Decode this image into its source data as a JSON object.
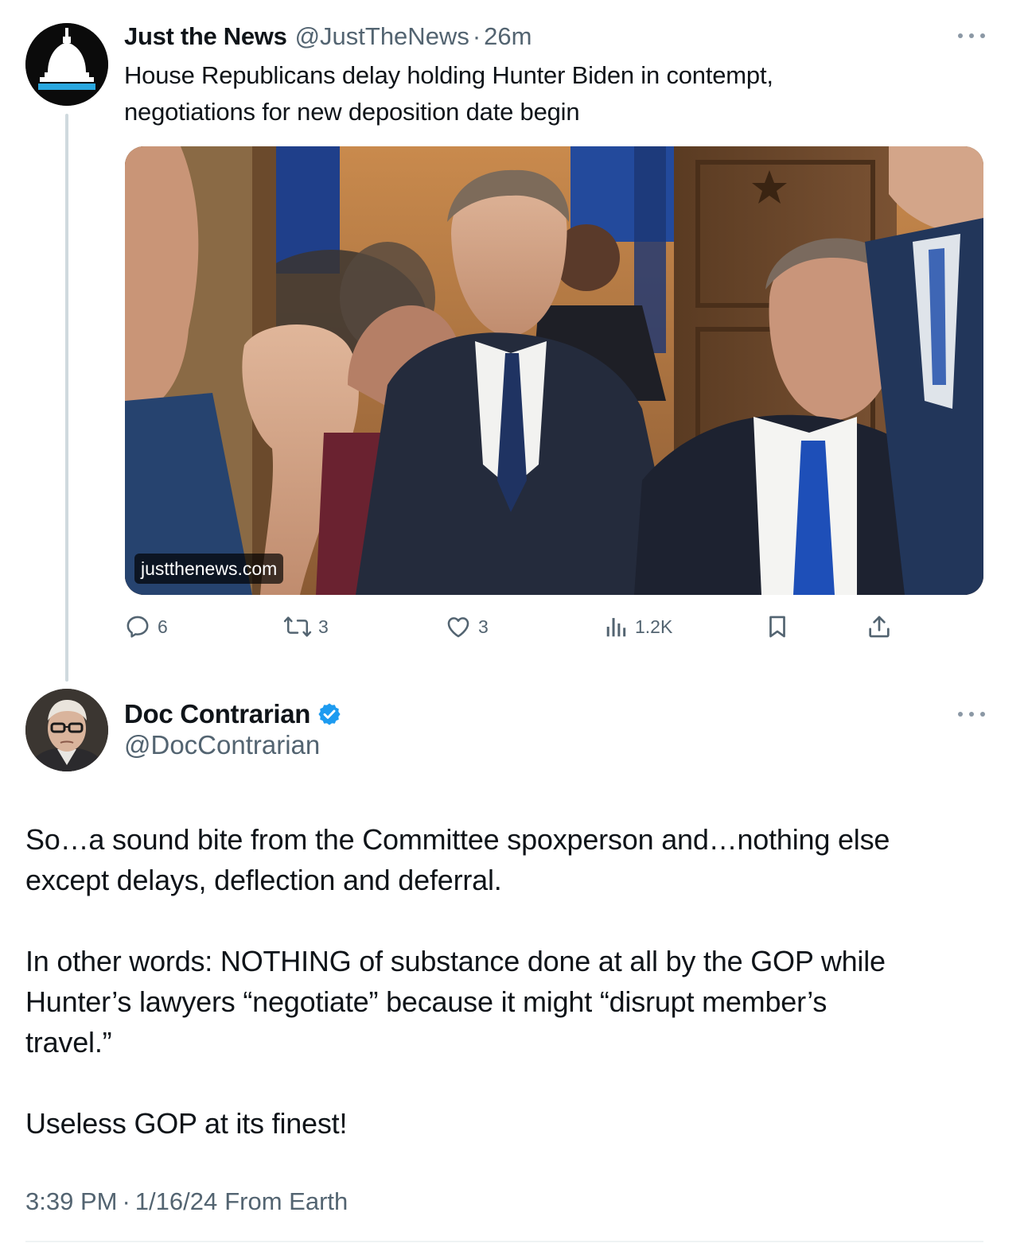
{
  "quoted_tweet": {
    "author_name": "Just the News",
    "handle": "@JustTheNews",
    "separator": "·",
    "time_ago": "26m",
    "text_lines": [
      "House Republicans delay holding Hunter Biden in contempt,",
      "negotiations for new deposition date begin"
    ],
    "link_card_domain": "justthenews.com",
    "stats": {
      "replies": "6",
      "retweets": "3",
      "likes": "3",
      "views": "1.2K"
    },
    "icons": {
      "avatar": "capitol-dome-logo",
      "more": "more-horizontal-icon",
      "reply": "reply-icon",
      "retweet": "retweet-icon",
      "like": "heart-icon",
      "views": "views-bar-chart-icon",
      "bookmark": "bookmark-icon",
      "share": "share-icon"
    }
  },
  "reply_tweet": {
    "author_name": "Doc Contrarian",
    "handle": "@DocContrarian",
    "verified": true,
    "paragraphs": [
      [
        "So…a sound bite from the Committee spoxperson and…nothing else",
        "except delays, deflection and deferral."
      ],
      [
        "In other words: NOTHING of substance done at all by the GOP while",
        "Hunter’s lawyers “negotiate” because it might “disrupt member’s",
        "travel.”"
      ],
      [
        "Useless GOP at its finest!"
      ]
    ],
    "time": "3:39 PM",
    "separator": "·",
    "date": "1/16/24",
    "location": "From Earth"
  },
  "colors": {
    "text_primary": "#0f1419",
    "text_secondary": "#536471",
    "verified_blue": "#1d9bf0",
    "thread_line": "#cfd9de",
    "logo_accent": "#29a8e0"
  }
}
